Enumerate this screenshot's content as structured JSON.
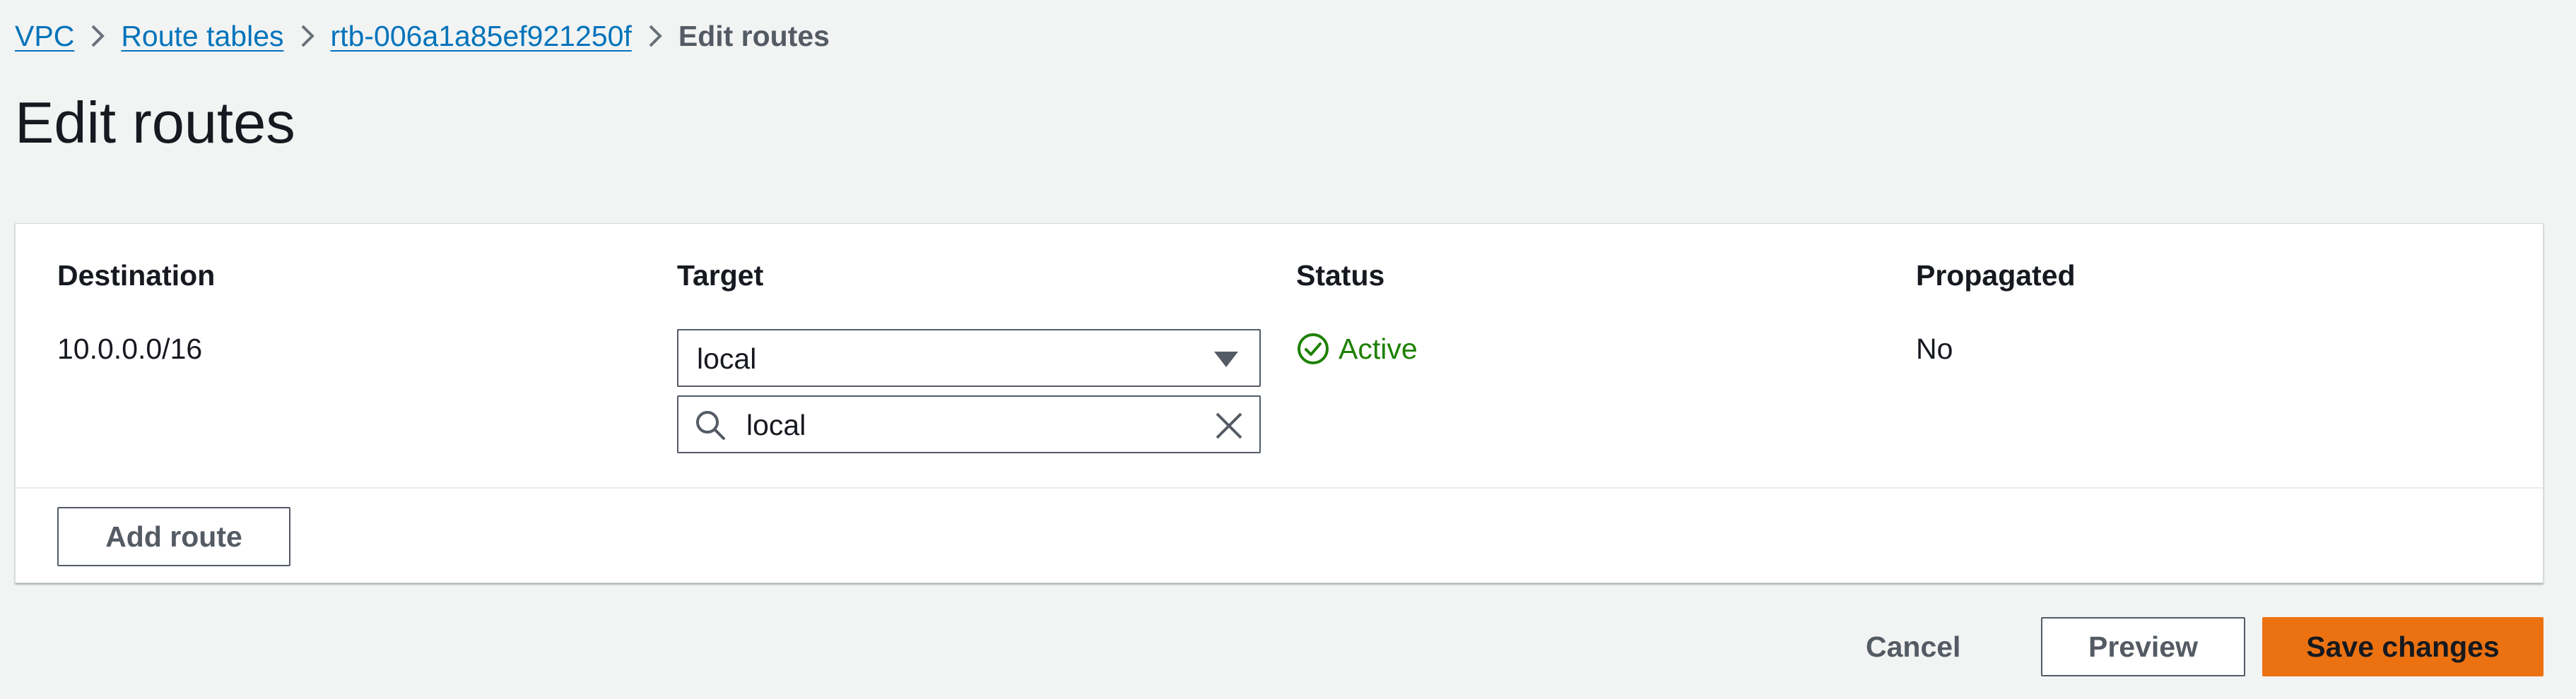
{
  "breadcrumb": {
    "items": [
      {
        "label": "VPC"
      },
      {
        "label": "Route tables"
      },
      {
        "label": "rtb-006a1a85ef921250f"
      }
    ],
    "current": "Edit routes"
  },
  "page": {
    "title": "Edit routes"
  },
  "routes_table": {
    "columns": [
      "Destination",
      "Target",
      "Status",
      "Propagated"
    ],
    "rows": [
      {
        "destination": "10.0.0.0/16",
        "target": "local",
        "target_filter": "local",
        "status": "Active",
        "propagated": "No"
      }
    ],
    "add_route_label": "Add route"
  },
  "footer": {
    "cancel_label": "Cancel",
    "preview_label": "Preview",
    "save_label": "Save changes"
  },
  "icons": {
    "breadcrumb_separator": "chevron-right-icon",
    "select_caret": "caret-down-icon",
    "filter_search": "search-icon",
    "filter_clear": "close-icon",
    "status": "check-circle-icon"
  },
  "colors": {
    "link": "#0073bb",
    "status_success": "#1d8102",
    "primary_button": "#ec7211",
    "background": "#f2f3f3"
  }
}
